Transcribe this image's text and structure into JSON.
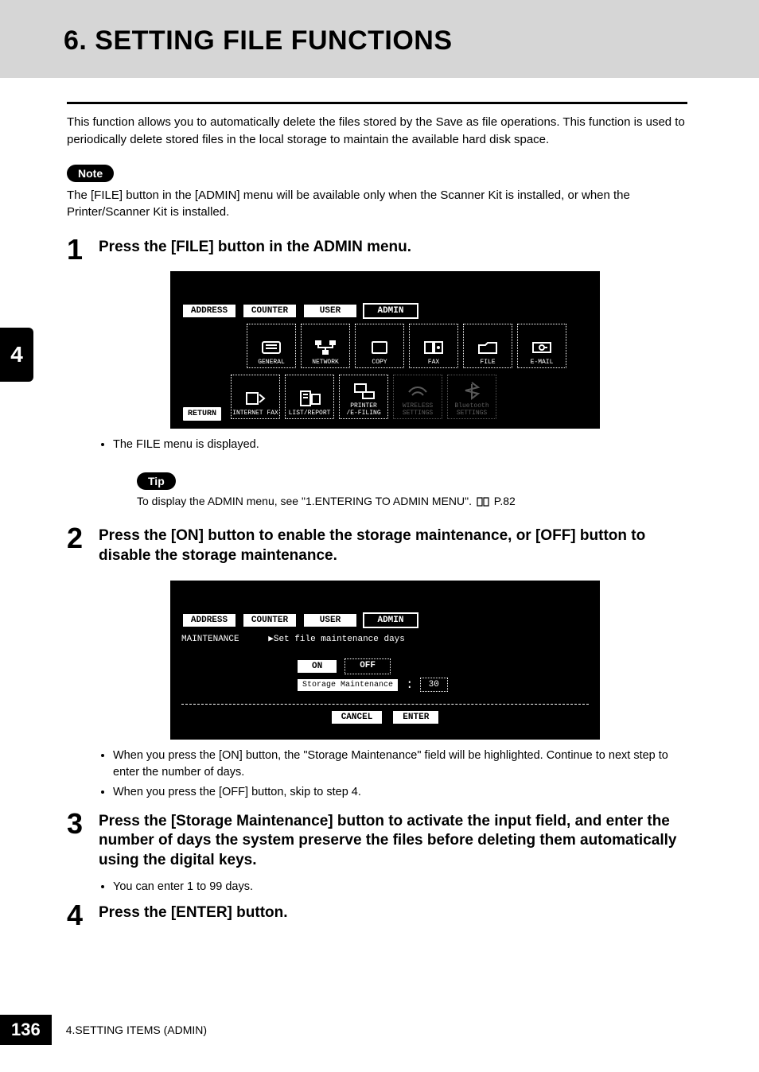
{
  "header": {
    "title": "6. SETTING FILE FUNCTIONS"
  },
  "side_tab": "4",
  "intro": "This function allows you to automatically delete the files stored by the Save as file operations.  This function is used to periodically delete stored files in the local storage to maintain the available hard disk space.",
  "note": {
    "label": "Note",
    "text": "The [FILE] button in the [ADMIN] menu will be available only when the Scanner Kit is installed, or when the Printer/Scanner Kit is installed."
  },
  "tip": {
    "label": "Tip",
    "text": "To display the ADMIN menu, see \"1.ENTERING TO ADMIN MENU\".",
    "page_ref": "P.82"
  },
  "steps": [
    {
      "num": "1",
      "title": "Press the [FILE] button in the ADMIN menu.",
      "sub_bullets": [
        "The FILE menu is displayed."
      ]
    },
    {
      "num": "2",
      "title": "Press the [ON] button to enable the storage maintenance, or [OFF] button to disable the storage maintenance.",
      "sub_bullets": [
        "When you press the [ON] button, the \"Storage Maintenance\" field will be highlighted.  Continue to next step to enter the number of days.",
        "When you press the [OFF] button, skip to step 4."
      ]
    },
    {
      "num": "3",
      "title": "Press the [Storage Maintenance] button to activate the input field, and enter the number of days the system preserve the files before deleting them automatically using the digital keys.",
      "sub_bullets": [
        "You can enter 1 to 99 days."
      ]
    },
    {
      "num": "4",
      "title": "Press the [ENTER] button."
    }
  ],
  "screen1": {
    "tabs": [
      "ADDRESS",
      "COUNTER",
      "USER",
      "ADMIN"
    ],
    "selected_tab_index": 3,
    "icons_row1": [
      "GENERAL",
      "NETWORK",
      "COPY",
      "FAX",
      "FILE",
      "E-MAIL"
    ],
    "icons_row2": [
      "INTERNET FAX",
      "LIST/REPORT",
      "PRINTER\n/E-FILING",
      "WIRELESS\nSETTINGS",
      "Bluetooth\nSETTINGS"
    ],
    "dimmed_row2_indices": [
      3,
      4
    ],
    "return": "RETURN"
  },
  "screen2": {
    "tabs": [
      "ADDRESS",
      "COUNTER",
      "USER",
      "ADMIN"
    ],
    "selected_tab_index": 3,
    "section_label": "MAINTENANCE",
    "prompt": "▶Set file maintenance days",
    "on": "ON",
    "off": "OFF",
    "sm_label": "Storage Maintenance",
    "sm_value": "30",
    "cancel": "CANCEL",
    "enter": "ENTER"
  },
  "footer": {
    "page": "136",
    "section": "4.SETTING ITEMS (ADMIN)"
  }
}
